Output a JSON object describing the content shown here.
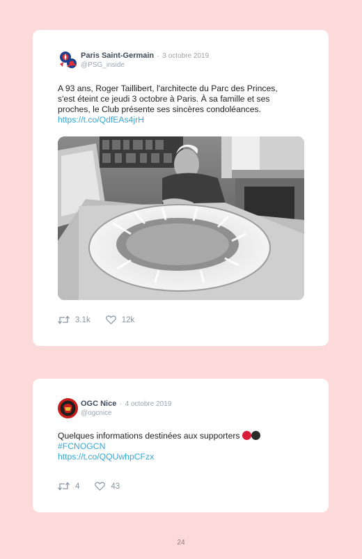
{
  "tweets": [
    {
      "author": "Paris Saint-Germain",
      "separator": "·",
      "date": "3 octobre 2019",
      "handle": "@PSG_inside",
      "text_lines": [
        "A 93 ans, Roger Taillibert, l'architecte du Parc des Princes,",
        "s'est éteint ce jeudi 3 octobre à Paris. À sa famille et ses",
        "proches, le Club présente ses sincères condoléances."
      ],
      "link": "https://t.co/QdfEAs4jrH",
      "retweets": "3.1k",
      "likes": "12k",
      "has_photo": true
    },
    {
      "author": "OGC Nice",
      "separator": "·",
      "date": "4 octobre 2019",
      "handle": "@ogcnice",
      "text_lines": [
        "Quelques informations destinées aux supporters"
      ],
      "emoji_colors": [
        "#d81e3a",
        "#2b2b2b"
      ],
      "hashtag": "#FCNOGCN",
      "link": "https://t.co/QQUwhpCFzx",
      "retweets": "4",
      "likes": "43"
    }
  ],
  "page_number": "24",
  "colors": {
    "background": "#fddada",
    "link": "#33a7d8",
    "meta": "#9aa4b0"
  },
  "icons": [
    "psg-logo-icon",
    "ogc-nice-logo-icon",
    "retweet-icon",
    "heart-icon"
  ]
}
